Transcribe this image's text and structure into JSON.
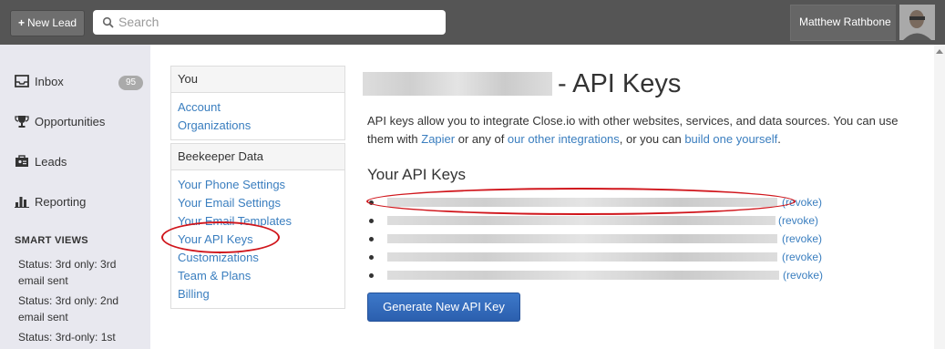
{
  "topbar": {
    "new_lead_label": "New Lead",
    "search_placeholder": "Search",
    "user_name": "Matthew Rathbone"
  },
  "sidebar": {
    "items": [
      {
        "label": "Inbox",
        "icon": "inbox-icon"
      },
      {
        "label": "Opportunities",
        "icon": "trophy-icon"
      },
      {
        "label": "Leads",
        "icon": "leads-icon"
      },
      {
        "label": "Reporting",
        "icon": "bar-chart-icon"
      }
    ],
    "inbox_count": "95",
    "smart_views_title": "SMART VIEWS",
    "smart_views": [
      "Status: 3rd only: 3rd email sent",
      "Status: 3rd only: 2nd email sent",
      "Status: 3rd-only: 1st"
    ]
  },
  "settings": {
    "you": {
      "title": "You",
      "links": [
        "Account",
        "Organizations"
      ]
    },
    "org": {
      "title": "Beekeeper Data",
      "links": [
        "Your Phone Settings",
        "Your Email Settings",
        "Your Email Templates",
        "Your API Keys",
        "Customizations",
        "Team & Plans",
        "Billing"
      ]
    }
  },
  "main": {
    "title_suffix": "- API Keys",
    "desc_part1": "API keys allow you to integrate Close.io with other websites, services, and data sources. You can use them with ",
    "zapier_link": "Zapier",
    "desc_part2": " or any of ",
    "integrations_link": "our other integrations",
    "desc_part3": ", or you can ",
    "build_link": "build one yourself",
    "desc_part4": ".",
    "subheading": "Your API Keys",
    "revoke_label": "(revoke)",
    "generate_button": "Generate New API Key"
  },
  "colors": {
    "topbar": "#555555",
    "link": "#3a7ebf",
    "button": "#2f66b8",
    "annotation": "#d0161c"
  }
}
